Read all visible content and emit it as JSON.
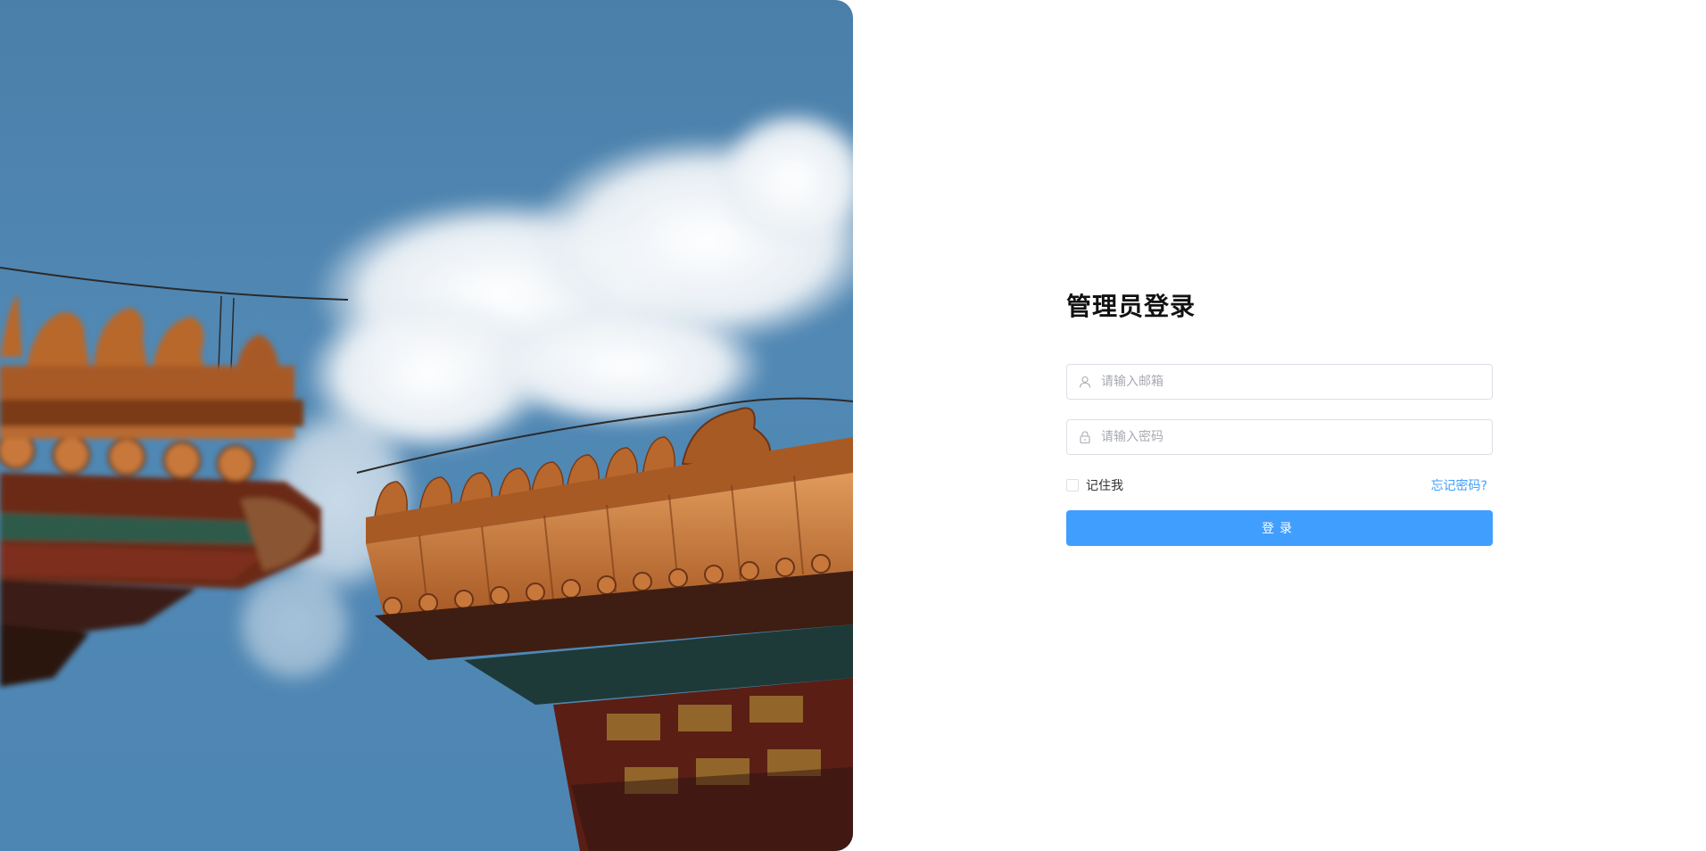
{
  "hero": {
    "image_subject": "forbidden-city-roof-ridges-against-sky",
    "colors": {
      "sky": "#4e86b3",
      "roof_tile": "#c8783a",
      "roof_dark": "#6b3419",
      "cloud": "#f2f5f8"
    }
  },
  "login": {
    "title": "管理员登录",
    "email_field": {
      "placeholder": "请输入邮箱",
      "value": "",
      "icon": "user-icon"
    },
    "password_field": {
      "placeholder": "请输入密码",
      "value": "",
      "icon": "lock-icon"
    },
    "remember_me_label": "记住我",
    "remember_me_checked": false,
    "forgot_password_label": "忘记密码?",
    "submit_label": "登录"
  },
  "colors": {
    "accent": "#409eff",
    "input_border": "#dcdfe6",
    "placeholder": "#a8abb2",
    "title": "#111111"
  }
}
